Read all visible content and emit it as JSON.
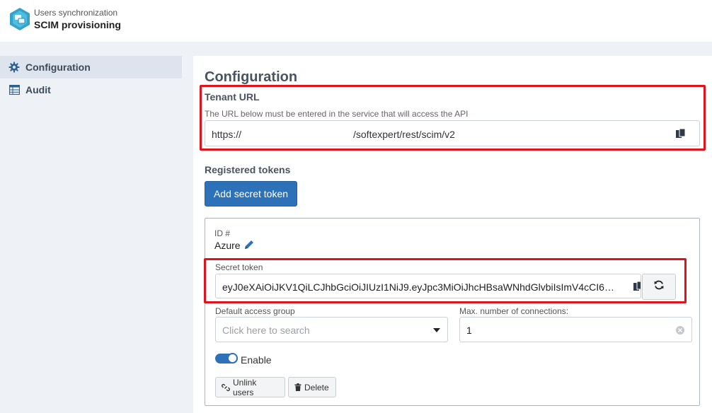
{
  "header": {
    "subtitle": "Users synchronization",
    "title": "SCIM provisioning",
    "logo_icon": "scim-sync-logo"
  },
  "sidebar": {
    "items": [
      {
        "label": "Configuration",
        "icon": "gear-icon",
        "active": true
      },
      {
        "label": "Audit",
        "icon": "table-icon",
        "active": false
      }
    ]
  },
  "main": {
    "title": "Configuration",
    "tenant": {
      "heading": "Tenant URL",
      "hint": "The URL below must be entered in the service that will access the API",
      "url_prefix": "https://",
      "url_suffix": "/softexpert/rest/scim/v2"
    },
    "tokens": {
      "heading": "Registered tokens",
      "add_button": "Add secret token",
      "card": {
        "id_label": "ID #",
        "id_value": "Azure",
        "secret_label": "Secret token",
        "secret_value": "eyJ0eXAiOiJKV1QiLCJhbGciOiJIUzI1NiJ9.eyJpc3MiOiJhcHBsaWNhdGlvbiIsImV4cCI6…",
        "group_label": "Default access group",
        "group_placeholder": "Click here to search",
        "max_label": "Max. number of connections:",
        "max_value": "1",
        "enable_label": "Enable",
        "enabled": true,
        "unlink_button": "Unlink users",
        "delete_button": "Delete"
      }
    }
  },
  "colors": {
    "accent": "#2d72b8",
    "highlight": "#e0121b",
    "background": "#eef2f7"
  }
}
